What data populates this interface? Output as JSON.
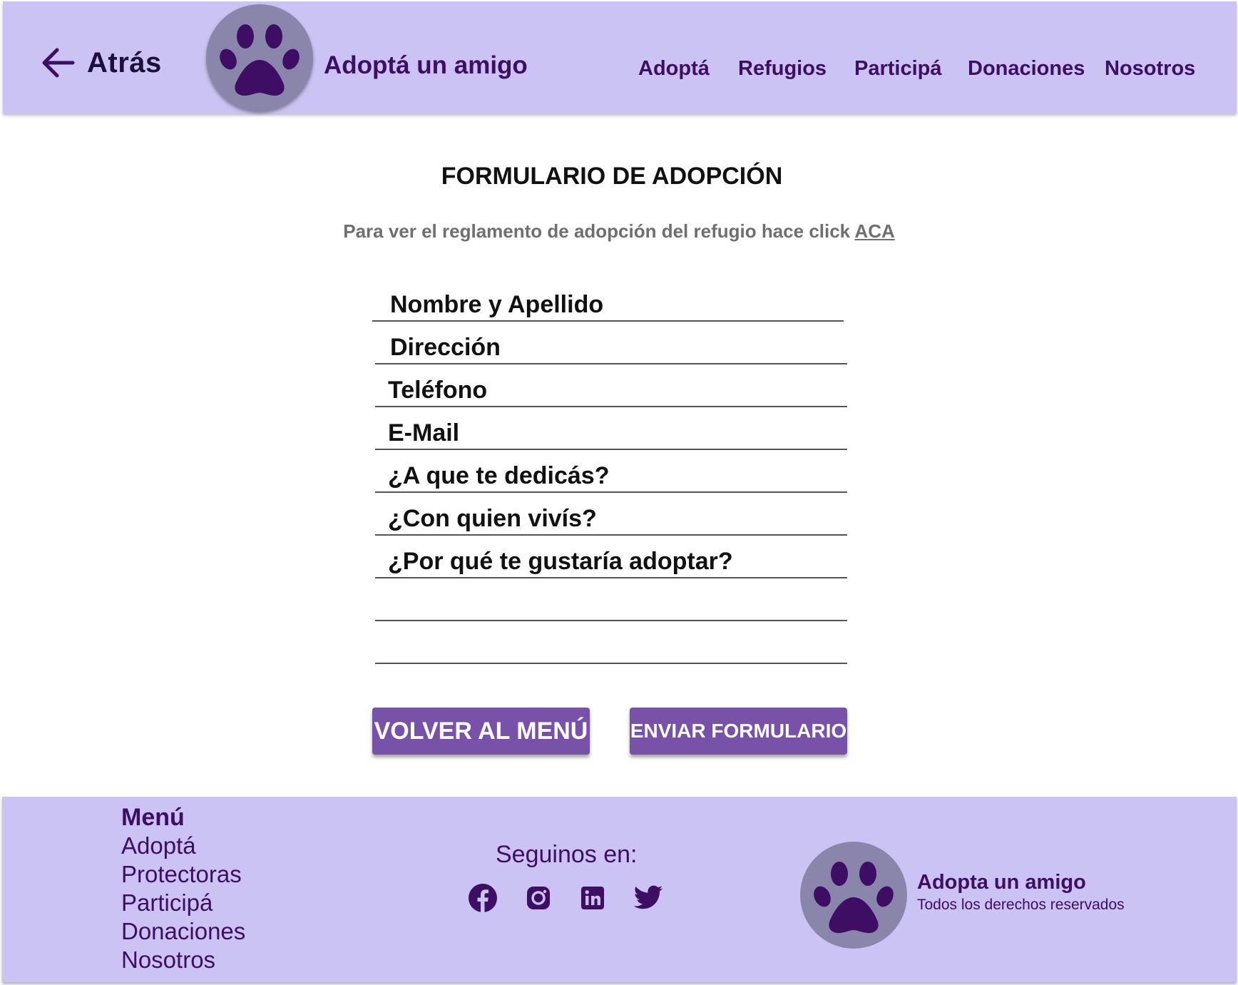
{
  "colors": {
    "header_bg": "#cac3f4",
    "brand_purple": "#3d0e63",
    "button_bg": "#7851a9",
    "logo_circle": "#8a85ab"
  },
  "header": {
    "back_label": "Atrás",
    "back_icon": "arrow-left-icon",
    "logo_icon": "paw-icon",
    "brand": "Adoptá un amigo",
    "nav": [
      {
        "label": "Adoptá"
      },
      {
        "label": "Refugios"
      },
      {
        "label": "Participá"
      },
      {
        "label": "Donaciones"
      },
      {
        "label": "Nosotros"
      }
    ]
  },
  "form": {
    "title": "FORMULARIO DE ADOPCIÓN",
    "subtitle": "Para ver el reglamento de adopción del refugio hace click",
    "subtitle_link": "ACA",
    "fields": [
      {
        "label": "Nombre y Apellido"
      },
      {
        "label": "Dirección"
      },
      {
        "label": "Teléfono"
      },
      {
        "label": "E-Mail"
      },
      {
        "label": "¿A que te dedicás?"
      },
      {
        "label": "¿Con quien vivís?"
      },
      {
        "label": "¿Por qué te gustaría adoptar?"
      },
      {
        "label": ""
      },
      {
        "label": ""
      }
    ],
    "back_button": "VOLVER AL MENÚ",
    "submit_button": "ENVIAR FORMULARIO"
  },
  "footer": {
    "menu_title": "Menú",
    "menu_items": [
      "Adoptá",
      "Protectoras",
      "Participá",
      "Donaciones",
      "Nosotros"
    ],
    "social_title": "Seguinos en:",
    "social_icons": [
      "facebook-icon",
      "instagram-icon",
      "linkedin-icon",
      "twitter-icon"
    ],
    "brand": "Adopta un amigo",
    "rights": "Todos los derechos reservados"
  }
}
